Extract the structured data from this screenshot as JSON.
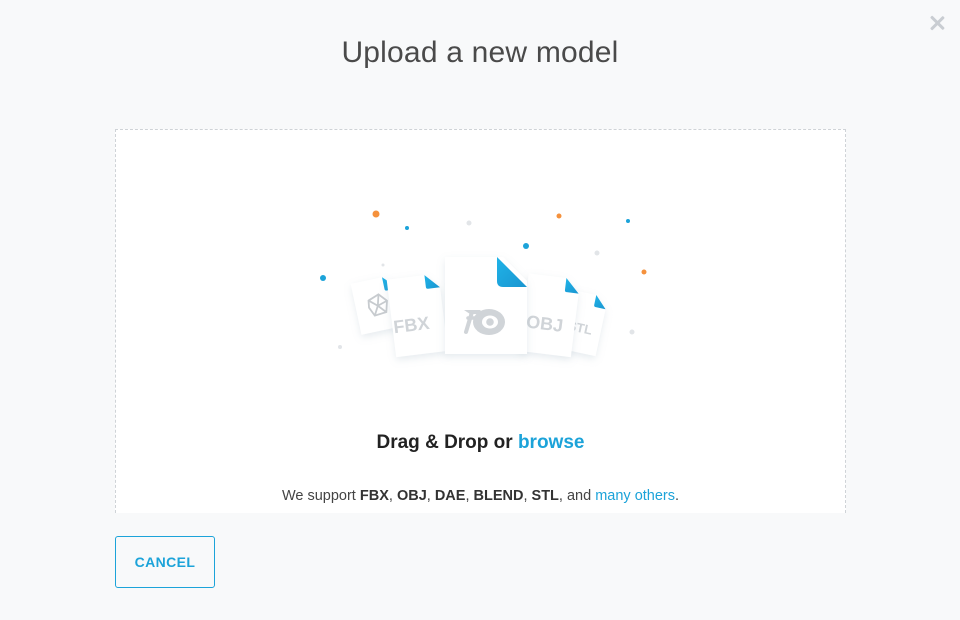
{
  "modal": {
    "title": "Upload a new model",
    "close_icon": "close-icon"
  },
  "dropzone": {
    "heading_prefix": "Drag & Drop or ",
    "browse_label": "browse",
    "support_prefix": "We support ",
    "formats": [
      "FBX",
      "OBJ",
      "DAE",
      "BLEND",
      "STL"
    ],
    "separator": ", ",
    "support_and": ", and ",
    "others_label": "many others",
    "support_suffix": ".",
    "file_labels": {
      "fbx": "FBX",
      "obj": "OBJ",
      "stl": "STL"
    },
    "icons": [
      "dae-file-icon",
      "fbx-file-icon",
      "blender-file-icon",
      "obj-file-icon",
      "stl-file-icon"
    ]
  },
  "footer": {
    "cancel_label": "CANCEL"
  },
  "colors": {
    "accent": "#1ca3d9",
    "dot_orange": "#f5913c",
    "dot_blue": "#1ca3d9",
    "dot_grey": "#dcdfe2"
  }
}
